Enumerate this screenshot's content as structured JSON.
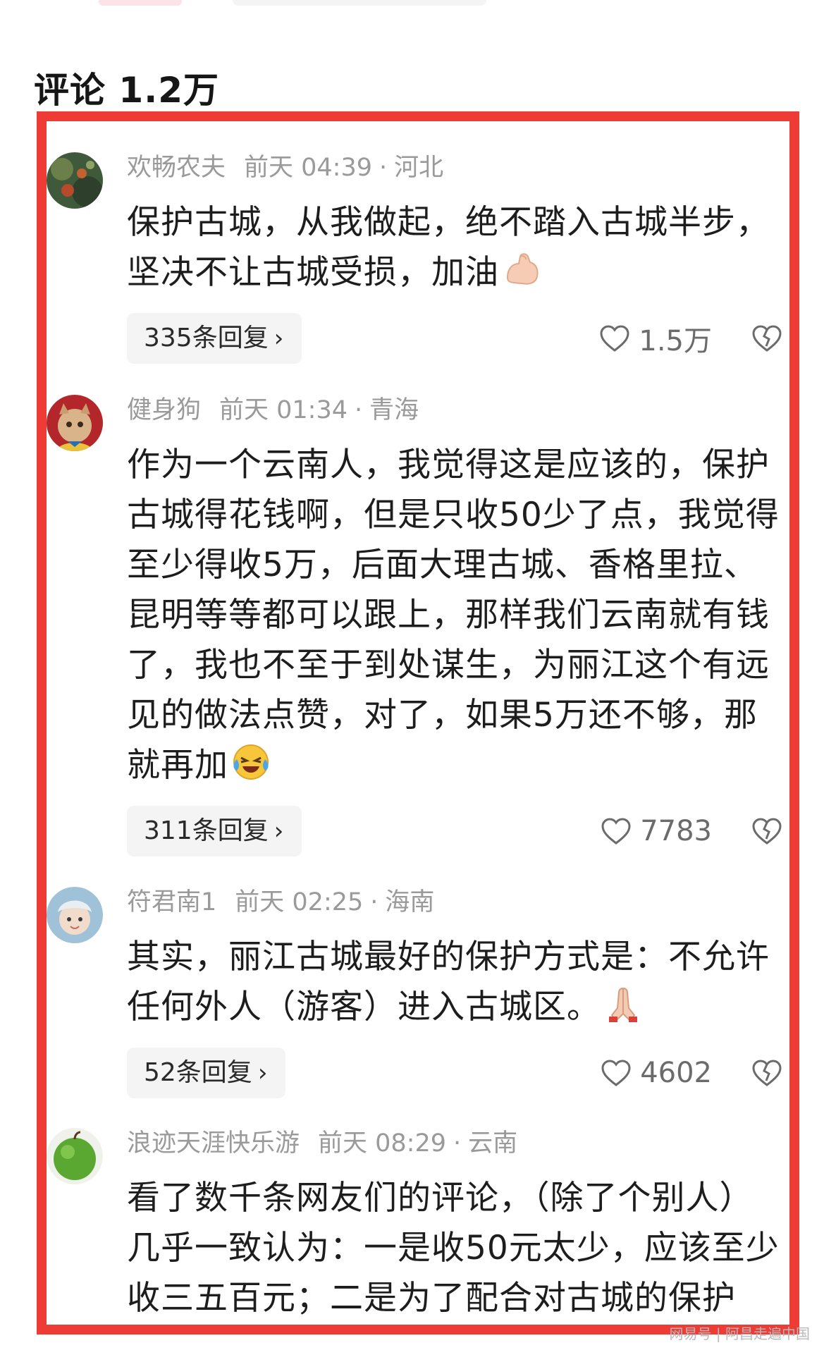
{
  "header": {
    "title": "评论 1.2万"
  },
  "comments": [
    {
      "user": "欢畅农夫",
      "time": "前天 04:39",
      "location": "河北",
      "text": "保护古城，从我做起，绝不踏入古城半步，坚决不让古城受损，加油",
      "emoji": "flexed-biceps-icon",
      "replies": "335条回复",
      "likes": "1.5万"
    },
    {
      "user": "健身狗",
      "time": "前天 01:34",
      "location": "青海",
      "text": "作为一个云南人，我觉得这是应该的，保护古城得花钱啊，但是只收50少了点，我觉得至少得收5万，后面大理古城、香格里拉、昆明等等都可以跟上，那样我们云南就有钱了，我也不至于到处谋生，为丽江这个有远见的做法点赞，对了，如果5万还不够，那就再加",
      "emoji": "laughing-crying-face-icon",
      "replies": "311条回复",
      "likes": "7783"
    },
    {
      "user": "符君南1",
      "time": "前天 02:25",
      "location": "海南",
      "text": "其实，丽江古城最好的保护方式是：不允许任何外人（游客）进入古城区。",
      "emoji": "folded-hands-icon",
      "replies": "52条回复",
      "likes": "4602"
    },
    {
      "user": "浪迹天涯快乐游",
      "time": "前天 08:29",
      "location": "云南",
      "text": "看了数千条网友们的评论，（除了个别人）几乎一致认为：一是收50元太少，应该至少收三五百元；二是为了配合对古城的保护"
    }
  ],
  "separator": "·",
  "chevron": "›",
  "watermark": "网易号 | 阿昌走遍中国",
  "colors": {
    "highlight": "#ec3c35",
    "meta": "#9a9a9a",
    "reply_bg": "#f4f4f4"
  }
}
